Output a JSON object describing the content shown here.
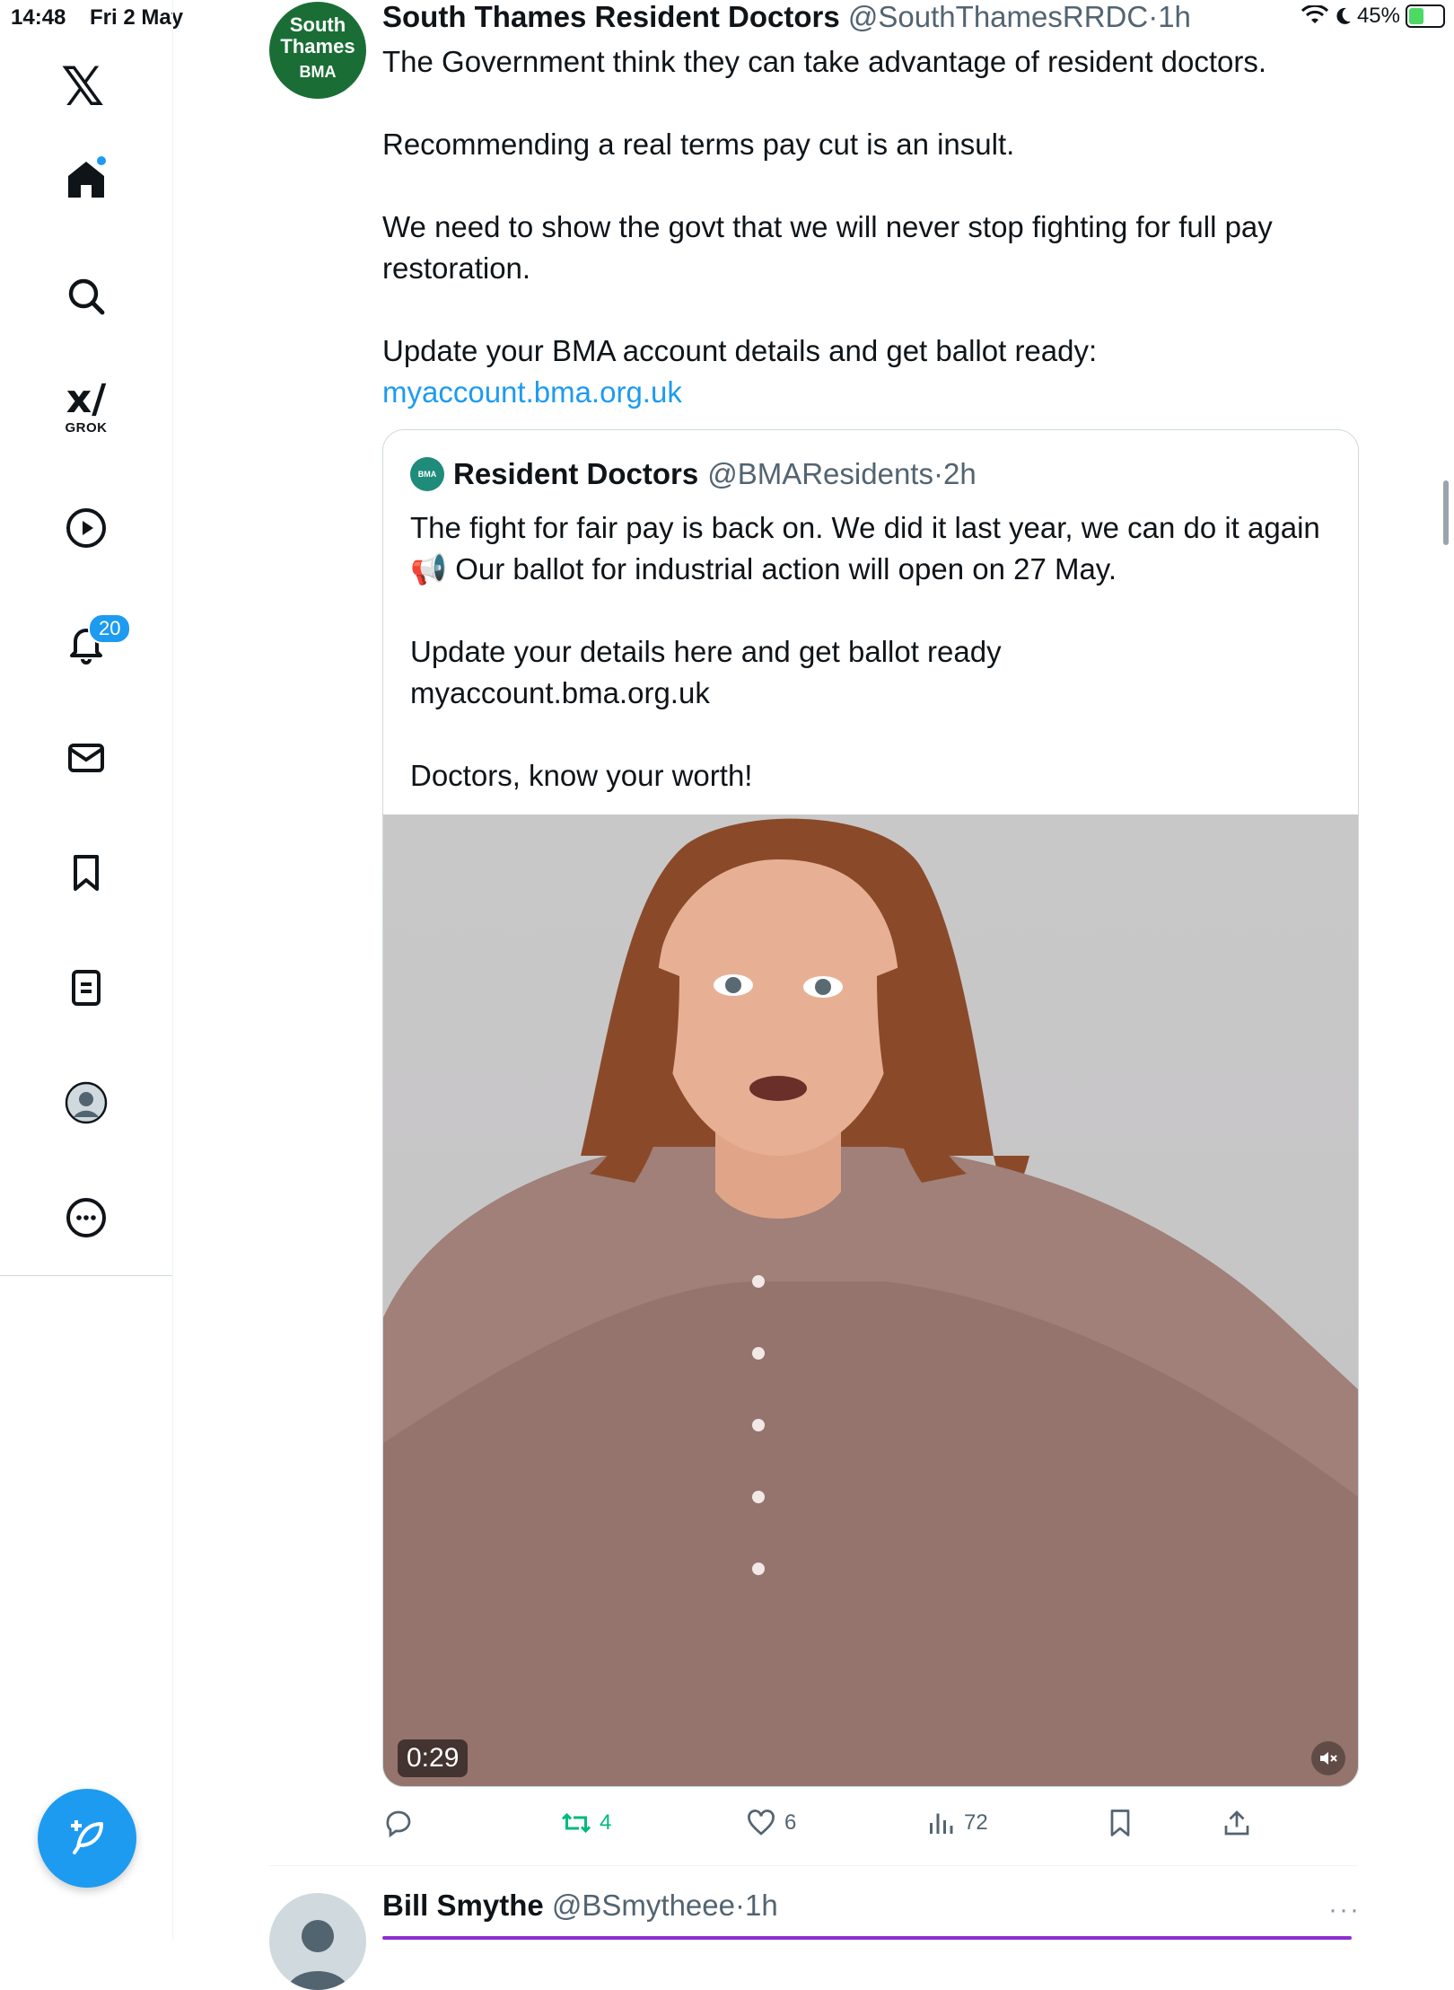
{
  "status_bar": {
    "time": "14:48",
    "date": "Fri 2 May",
    "battery": "45%"
  },
  "sidebar": {
    "grok_label": "GROK",
    "notifications_count": "20"
  },
  "tweet": {
    "avatar": {
      "line1": "South",
      "line2": "Thames",
      "line3": "BMA"
    },
    "author_name": "South Thames Resident Doctors",
    "author_handle": "@SouthThamesRRDC",
    "time": "1h",
    "paragraphs": [
      "The Government think they can take advantage of resident doctors.",
      "Recommending a real terms pay cut is an insult.",
      "We need to show the govt that we will never stop fighting for full pay restoration.",
      "Update your BMA account details and get ballot ready:"
    ],
    "link": "myaccount.bma.org.uk",
    "quote": {
      "avatar_text": "BMA",
      "author_name": "Resident Doctors",
      "author_handle": "@BMAResidents",
      "time": "2h",
      "para1": "The fight for fair pay is back on. We did it last year, we can do it again 📢 Our ballot for industrial action will open on 27 May.",
      "para2_line1": "Update your details here and get ballot ready",
      "para2_line2": "myaccount.bma.org.uk",
      "para3": "Doctors, know your worth!",
      "video_duration": "0:29"
    },
    "actions": {
      "reposts": "4",
      "likes": "6",
      "views": "72"
    }
  },
  "next_tweet": {
    "author_name": "Bill Smythe",
    "author_handle": "@BSmytheee",
    "time": "1h",
    "more": "···"
  },
  "colors": {
    "accent": "#1d9bf0",
    "repost_green": "#00ba7c",
    "avatar_green": "#1a6e35"
  }
}
